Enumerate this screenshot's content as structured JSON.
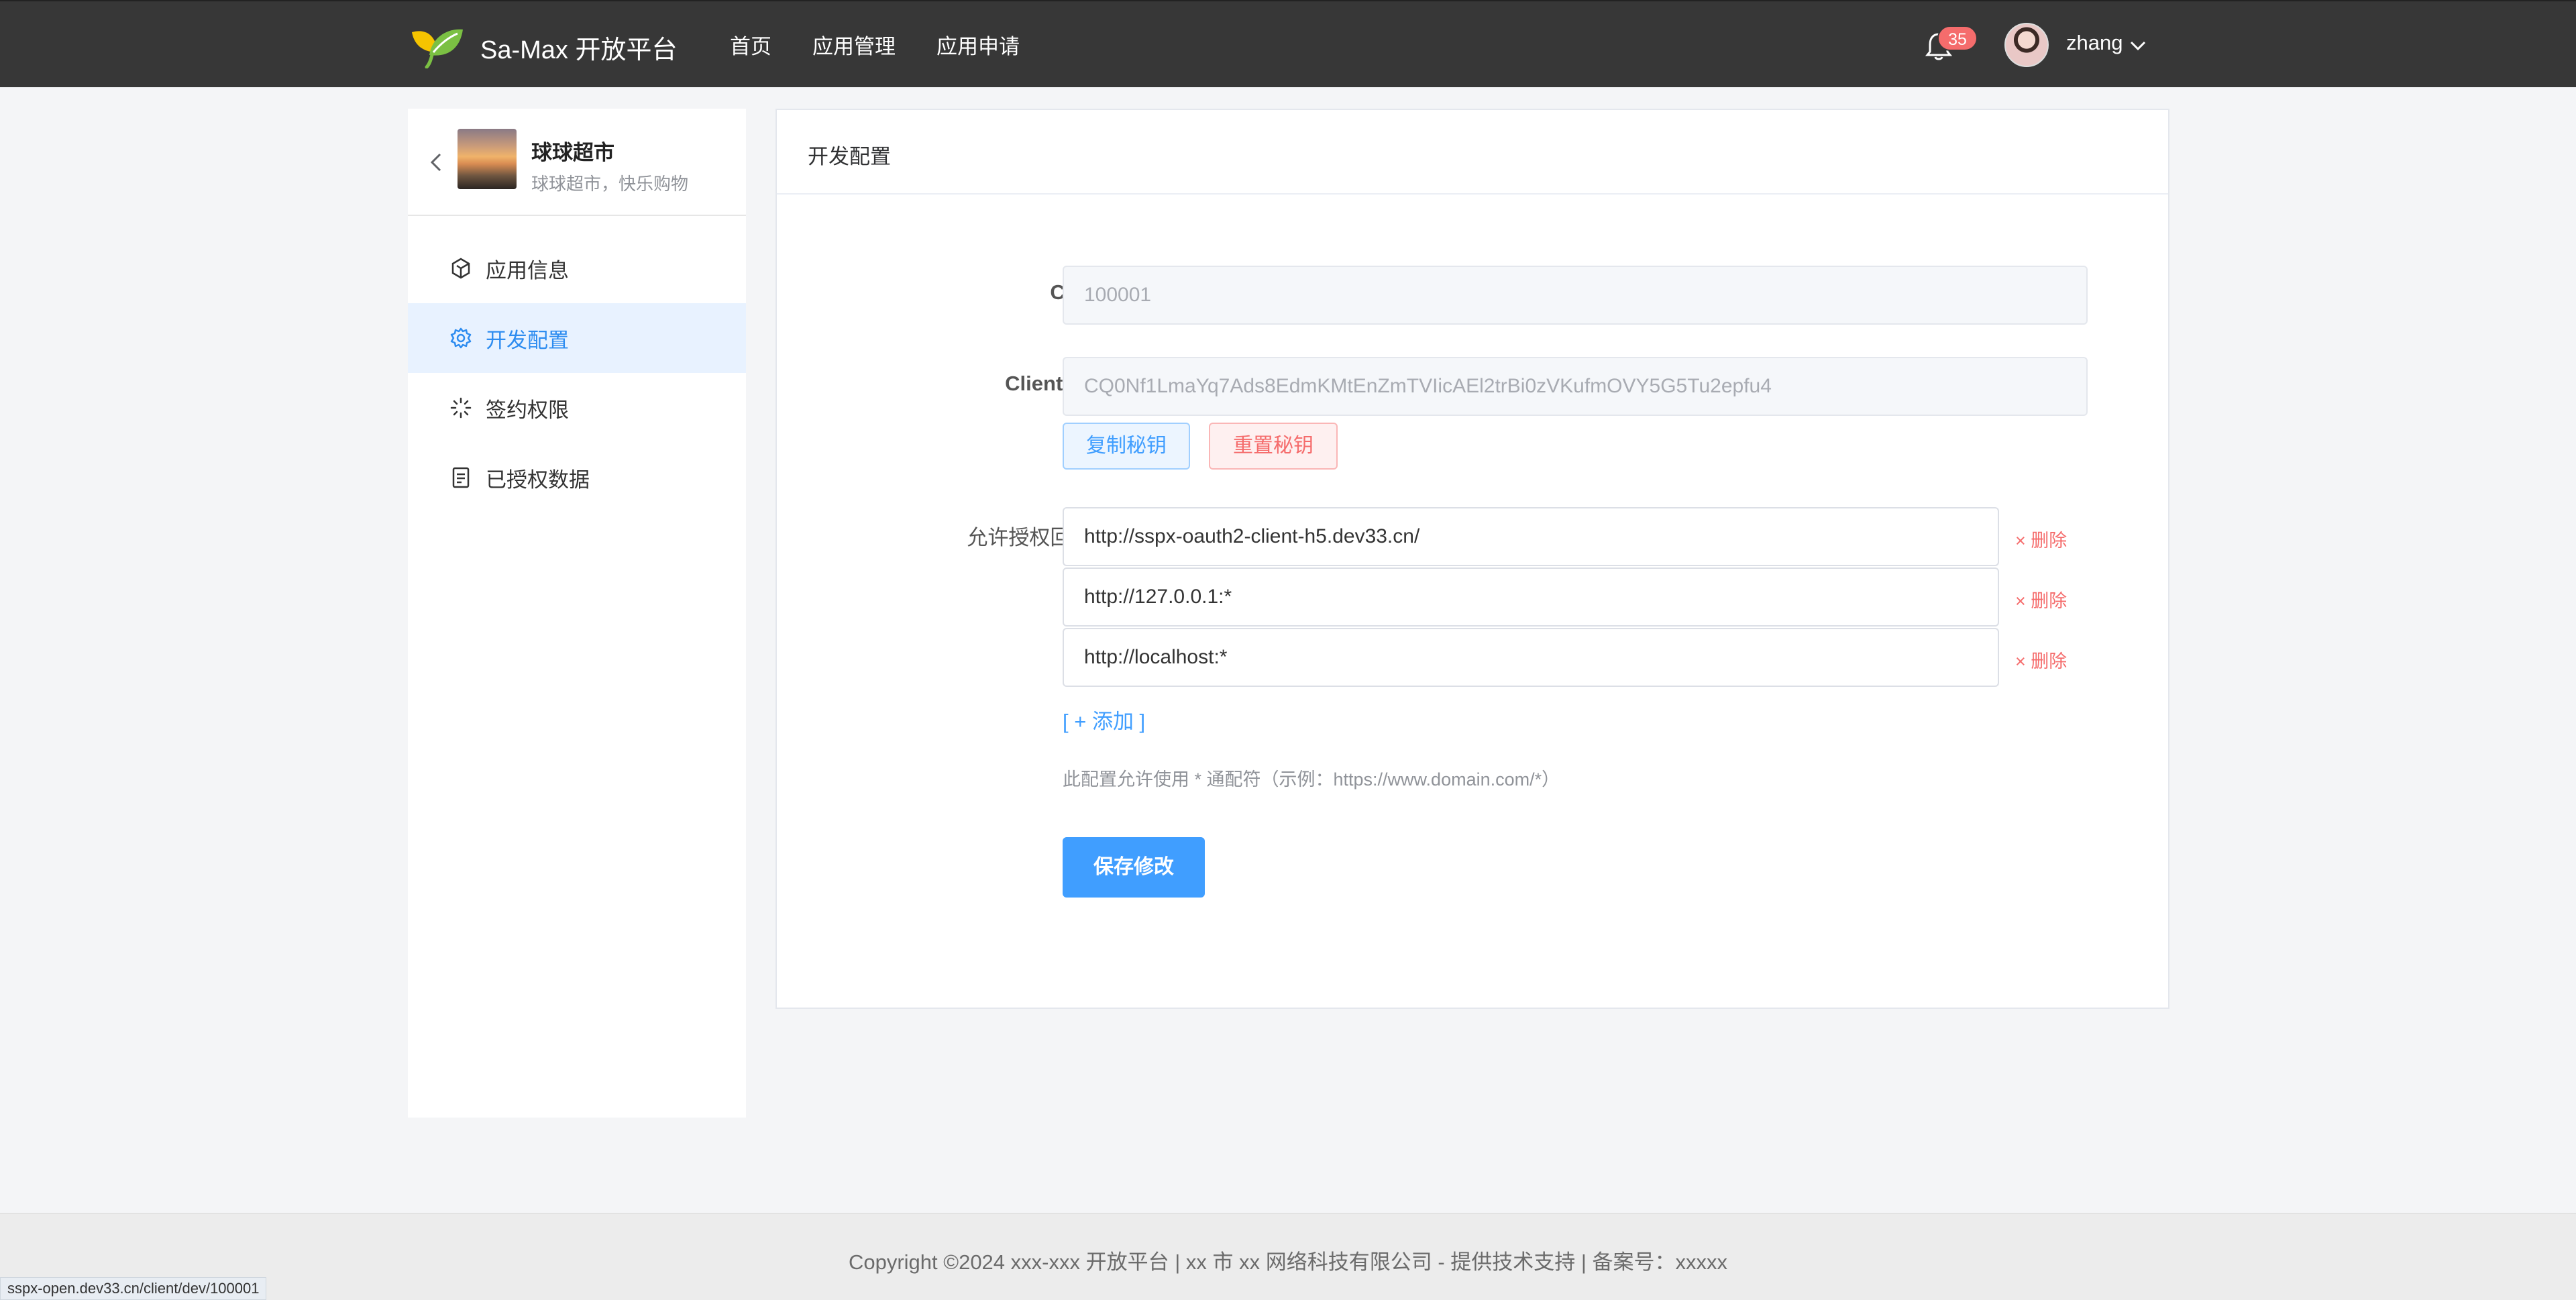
{
  "header": {
    "brand_name": "Sa-Max 开放平台",
    "logo_icon": "leaf-logo-icon",
    "nav": [
      {
        "label": "首页"
      },
      {
        "label": "应用管理"
      },
      {
        "label": "应用申请"
      }
    ],
    "notification_count": "35",
    "user_name": "zhang"
  },
  "sidebar": {
    "app_name": "球球超市",
    "app_desc": "球球超市，快乐购物",
    "menu": [
      {
        "label": "应用信息",
        "icon": "cube-icon"
      },
      {
        "label": "开发配置",
        "icon": "gear-icon",
        "active": true
      },
      {
        "label": "签约权限",
        "icon": "loading-icon"
      },
      {
        "label": "已授权数据",
        "icon": "document-icon"
      }
    ]
  },
  "main": {
    "title": "开发配置",
    "client_id_label": "Client Id:",
    "client_id_value": "100001",
    "client_secret_label": "Client Secret:",
    "client_secret_value": "CQ0Nf1LmaYq7Ads8EdmKMtEnZmTVIicAEl2trBi0zVKufmOVY5G5Tu2epfu4",
    "copy_secret_label": "复制秘钥",
    "reset_secret_label": "重置秘钥",
    "redirect_label": "允许授权回调地址:",
    "redirect_urls": [
      "http://sspx-oauth2-client-h5.dev33.cn/",
      "http://127.0.0.1:*",
      "http://localhost:*"
    ],
    "delete_label": "× 删除",
    "add_label": "[ + 添加 ]",
    "hint": "此配置允许使用 * 通配符（示例：https://www.domain.com/*）",
    "save_label": "保存修改"
  },
  "footer": {
    "text": "Copyright ©2024 xxx-xxx 开放平台 | xx 市 xx 网络科技有限公司 - 提供技术支持 | 备案号：xxxxx"
  },
  "status_bar": {
    "url": "sspx-open.dev33.cn/client/dev/100001"
  },
  "colors": {
    "topbar": "#373737",
    "primary": "#409eff",
    "danger": "#f56c6c",
    "active_menu_bg": "#e8f2ff"
  }
}
